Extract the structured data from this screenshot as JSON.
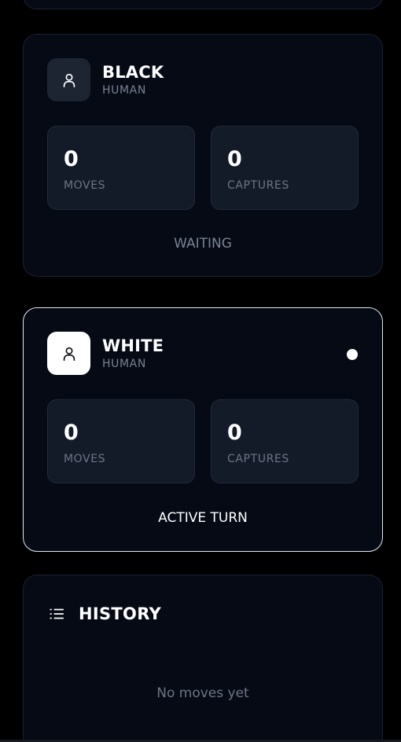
{
  "players": {
    "black": {
      "name": "BLACK",
      "type": "HUMAN",
      "moves_value": "0",
      "moves_label": "MOVES",
      "captures_value": "0",
      "captures_label": "CAPTURES",
      "status": "WAITING",
      "icon": "user-icon"
    },
    "white": {
      "name": "WHITE",
      "type": "HUMAN",
      "moves_value": "0",
      "moves_label": "MOVES",
      "captures_value": "0",
      "captures_label": "CAPTURES",
      "status": "ACTIVE TURN",
      "icon": "user-icon",
      "active_indicator": true
    }
  },
  "history": {
    "title": "HISTORY",
    "icon": "list-icon",
    "empty_text": "No moves yet"
  },
  "colors": {
    "background": "#000000",
    "card": "#050a15",
    "stat_box": "#131a28",
    "active_border": "#e6e9ef",
    "muted_text": "#7a8293"
  }
}
